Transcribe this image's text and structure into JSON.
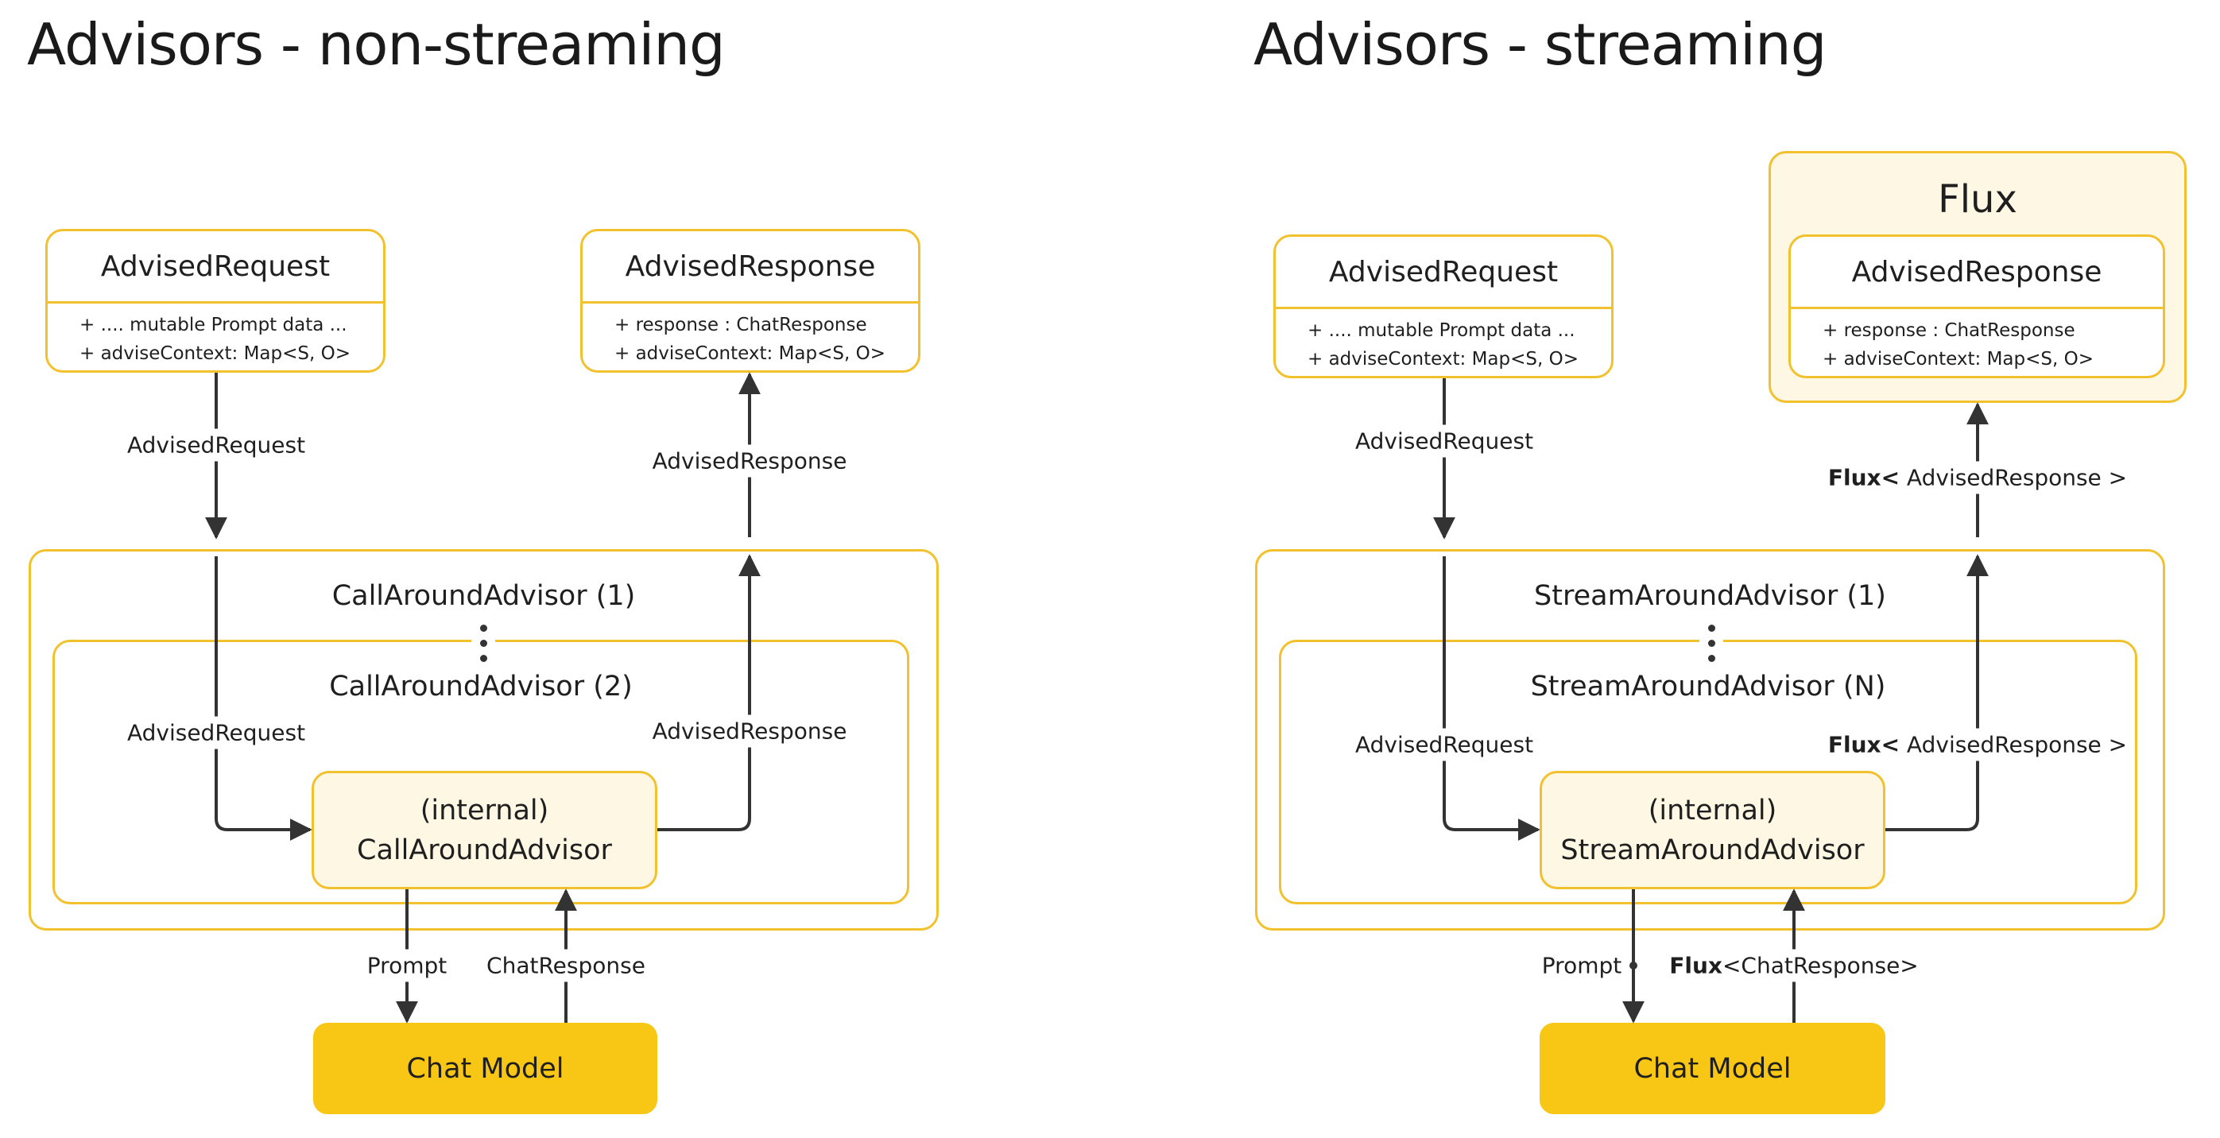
{
  "colors": {
    "box_border": "#f2c12e",
    "box_fill_light": "#fdf7e3",
    "chat_model_fill": "#f8c614",
    "arrow": "#333333"
  },
  "left": {
    "title": "Advisors - non-streaming",
    "request_box": {
      "name": "AdvisedRequest",
      "fields": [
        "+ .... mutable Prompt data ...",
        "+ adviseContext: Map<S, O>"
      ]
    },
    "response_box": {
      "name": "AdvisedResponse",
      "fields": [
        "+ response : ChatResponse",
        "+ adviseContext: Map<S, O>"
      ]
    },
    "outer_advisor": "CallAroundAdvisor (1)",
    "inner_advisor": "CallAroundAdvisor (2)",
    "internal_line1": "(internal)",
    "internal_line2": "CallAroundAdvisor",
    "chat_model": "Chat Model",
    "edge_labels": {
      "request_top": "AdvisedRequest",
      "response_top": "AdvisedResponse",
      "request_inner": "AdvisedRequest",
      "response_inner": "AdvisedResponse",
      "prompt": "Prompt",
      "chat_response": "ChatResponse"
    }
  },
  "right": {
    "title": "Advisors - streaming",
    "request_box": {
      "name": "AdvisedRequest",
      "fields": [
        "+ .... mutable Prompt data ...",
        "+ adviseContext: Map<S, O>"
      ]
    },
    "flux_box": {
      "title": "Flux",
      "name": "AdvisedResponse",
      "fields": [
        "+ response : ChatResponse",
        "+ adviseContext: Map<S, O>"
      ]
    },
    "outer_advisor": "StreamAroundAdvisor (1)",
    "inner_advisor": "StreamAroundAdvisor (N)",
    "internal_line1": "(internal)",
    "internal_line2": "StreamAroundAdvisor",
    "chat_model": "Chat Model",
    "edge_labels": {
      "request_top": "AdvisedRequest",
      "response_top_bold": "Flux<",
      "response_top_rest": " AdvisedResponse >",
      "request_inner": "AdvisedRequest",
      "response_inner_bold": "Flux<",
      "response_inner_rest": " AdvisedResponse >",
      "prompt": "Prompt",
      "chat_response_bold": "Flux",
      "chat_response_rest": "<ChatResponse>"
    }
  }
}
